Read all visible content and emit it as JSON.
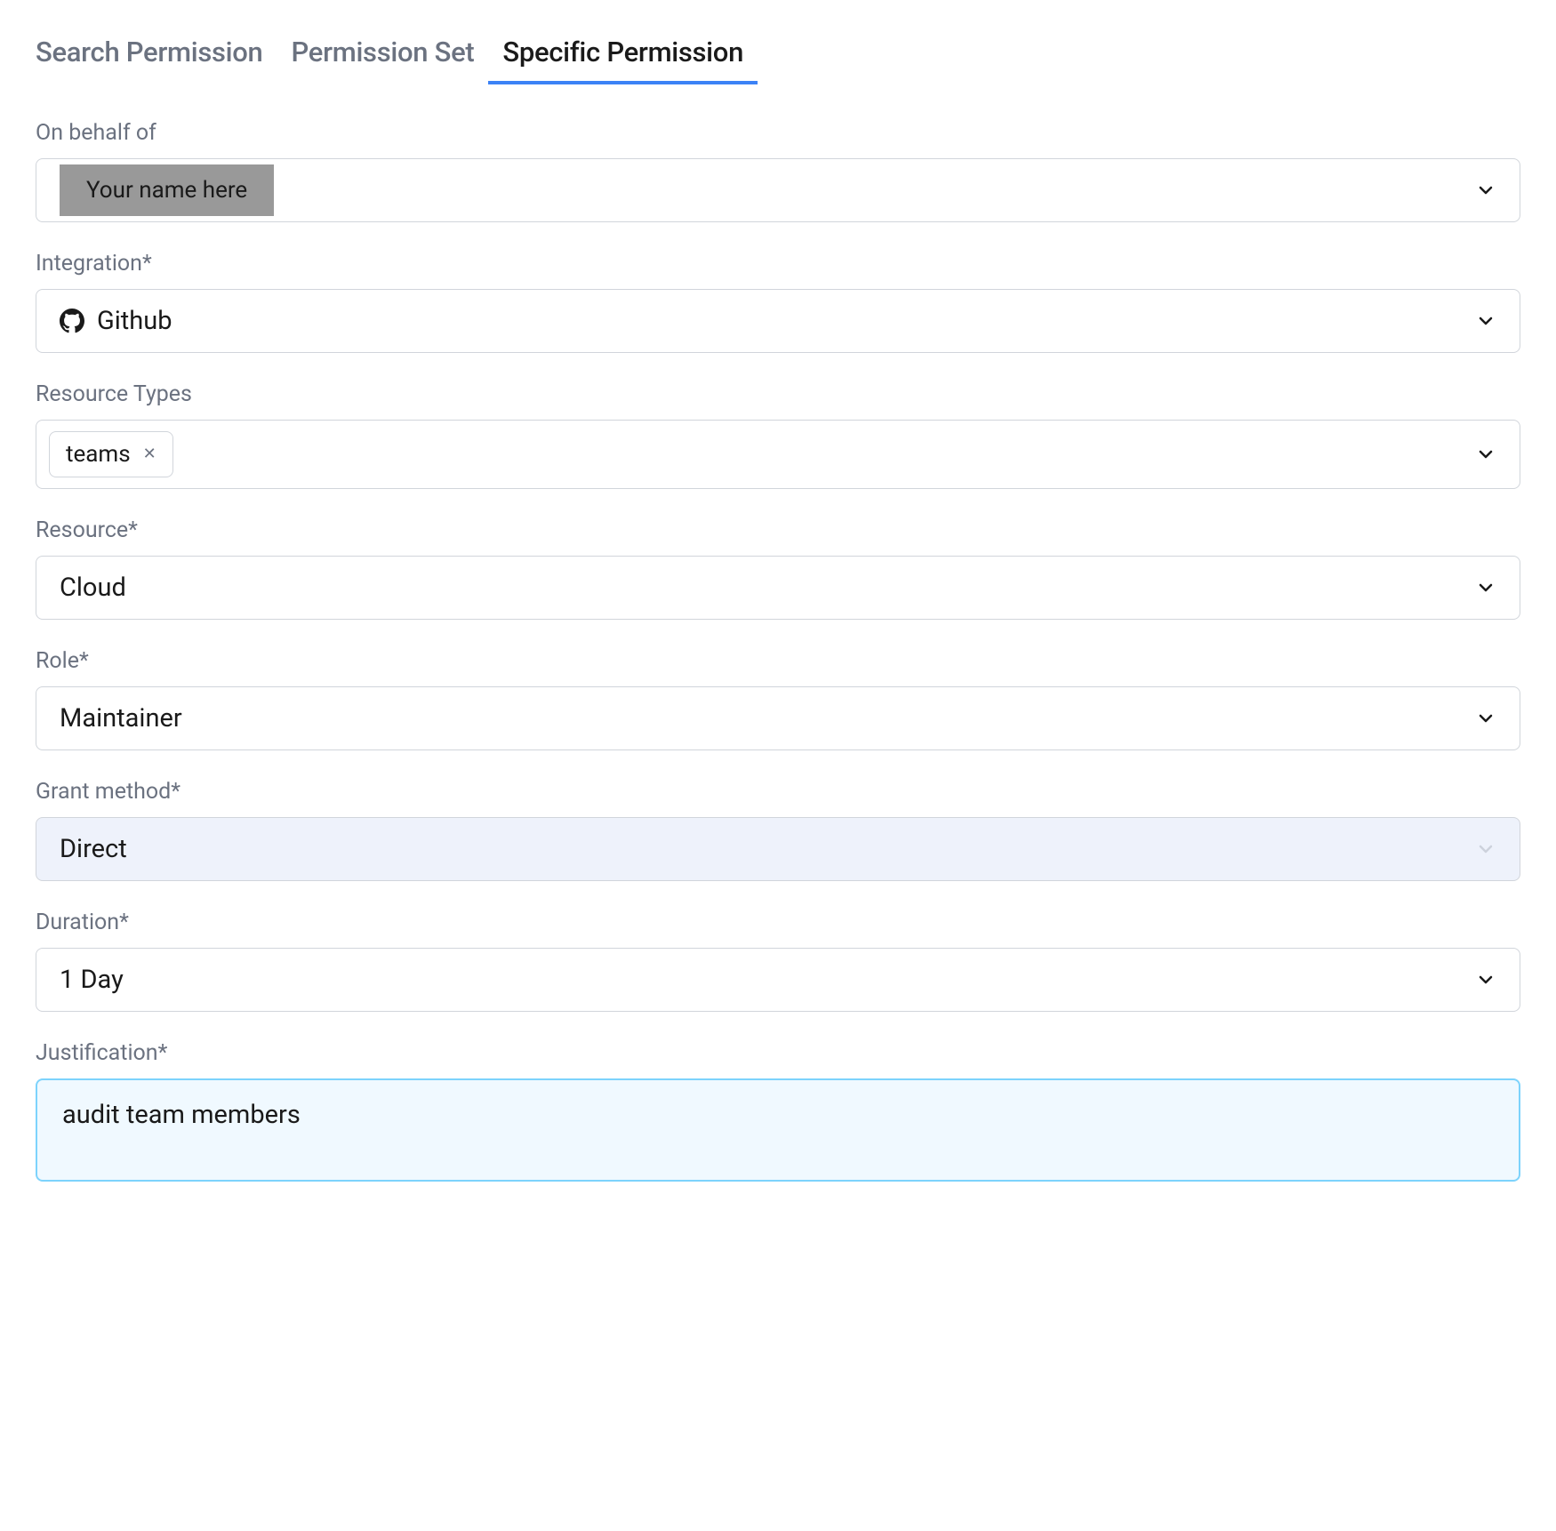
{
  "tabs": {
    "search_permission": "Search Permission",
    "permission_set": "Permission Set",
    "specific_permission": "Specific Permission"
  },
  "fields": {
    "on_behalf_of": {
      "label": "On behalf of",
      "placeholder": "Your name here"
    },
    "integration": {
      "label": "Integration*",
      "value": "Github",
      "icon": "github-icon"
    },
    "resource_types": {
      "label": "Resource Types",
      "tags": [
        "teams"
      ]
    },
    "resource": {
      "label": "Resource*",
      "value": "Cloud"
    },
    "role": {
      "label": "Role*",
      "value": "Maintainer"
    },
    "grant_method": {
      "label": "Grant method*",
      "value": "Direct"
    },
    "duration": {
      "label": "Duration*",
      "value": "1 Day"
    },
    "justification": {
      "label": "Justification*",
      "value": "audit team members"
    }
  }
}
